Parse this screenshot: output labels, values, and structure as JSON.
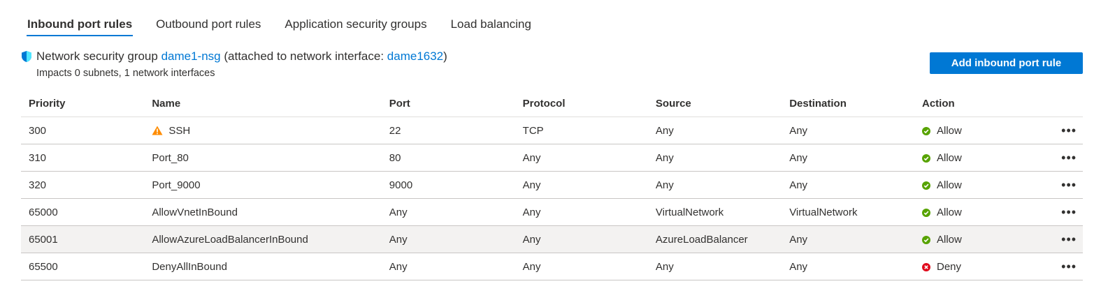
{
  "tabs": [
    {
      "label": "Inbound port rules",
      "active": true
    },
    {
      "label": "Outbound port rules",
      "active": false
    },
    {
      "label": "Application security groups",
      "active": false
    },
    {
      "label": "Load balancing",
      "active": false
    }
  ],
  "nsg": {
    "prefix": "Network security group",
    "name": "dame1-nsg",
    "middle": "(attached to network interface:",
    "interface": "dame1632",
    "suffix": ")",
    "impacts": "Impacts 0 subnets, 1 network interfaces",
    "icon": "shield-icon"
  },
  "add_button": {
    "label": "Add inbound port rule"
  },
  "table": {
    "headers": [
      "Priority",
      "Name",
      "Port",
      "Protocol",
      "Source",
      "Destination",
      "Action"
    ],
    "rows": [
      {
        "priority": "300",
        "name": "SSH",
        "warning": true,
        "port": "22",
        "protocol": "TCP",
        "source": "Any",
        "destination": "Any",
        "action": "Allow"
      },
      {
        "priority": "310",
        "name": "Port_80",
        "warning": false,
        "port": "80",
        "protocol": "Any",
        "source": "Any",
        "destination": "Any",
        "action": "Allow"
      },
      {
        "priority": "320",
        "name": "Port_9000",
        "warning": false,
        "port": "9000",
        "protocol": "Any",
        "source": "Any",
        "destination": "Any",
        "action": "Allow"
      },
      {
        "priority": "65000",
        "name": "AllowVnetInBound",
        "warning": false,
        "port": "Any",
        "protocol": "Any",
        "source": "VirtualNetwork",
        "destination": "VirtualNetwork",
        "action": "Allow"
      },
      {
        "priority": "65001",
        "name": "AllowAzureLoadBalancerInBound",
        "warning": false,
        "port": "Any",
        "protocol": "Any",
        "source": "AzureLoadBalancer",
        "destination": "Any",
        "action": "Allow",
        "highlighted": true
      },
      {
        "priority": "65500",
        "name": "DenyAllInBound",
        "warning": false,
        "port": "Any",
        "protocol": "Any",
        "source": "Any",
        "destination": "Any",
        "action": "Deny"
      }
    ],
    "more_label": "•••"
  },
  "colors": {
    "accent": "#0078d4",
    "allow": "#57a300",
    "deny": "#e00b1c",
    "warning": "#ff8c00"
  }
}
